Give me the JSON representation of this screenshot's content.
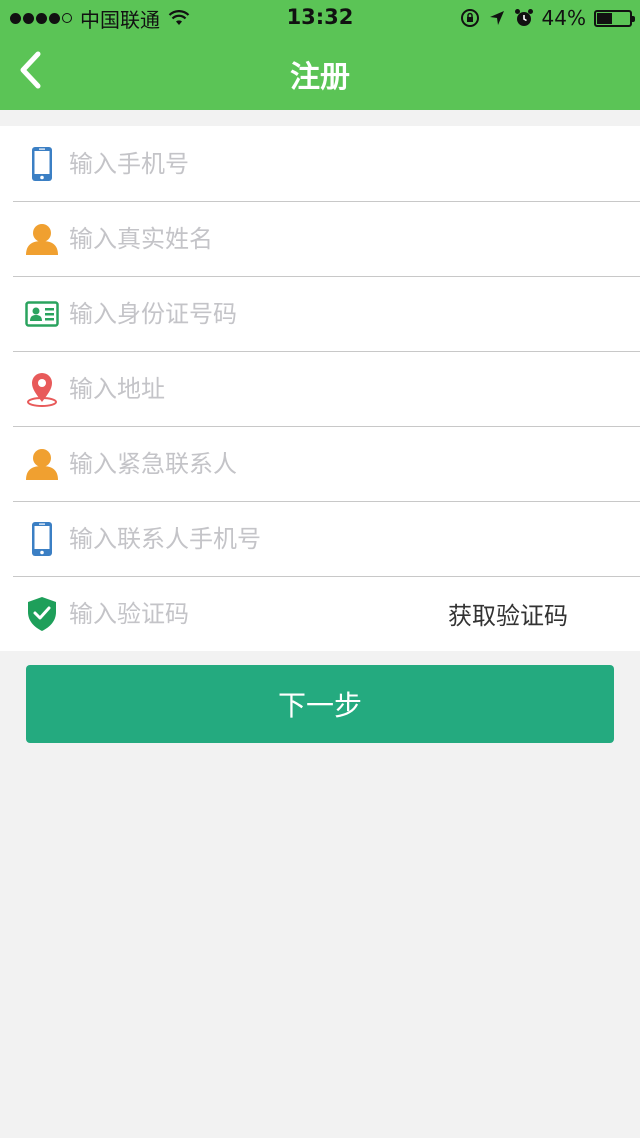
{
  "status_bar": {
    "carrier": "中国联通",
    "time": "13:32",
    "battery_text": "44%",
    "battery_level": 0.44
  },
  "nav": {
    "title": "注册",
    "back_icon": "chevron-left-icon"
  },
  "form": {
    "fields": [
      {
        "placeholder": "输入手机号",
        "icon": "phone-icon",
        "icon_color": "#3b7fc4"
      },
      {
        "placeholder": "输入真实姓名",
        "icon": "user-icon",
        "icon_color": "#f0a030"
      },
      {
        "placeholder": "输入身份证号码",
        "icon": "id-card-icon",
        "icon_color": "#2aa35e"
      },
      {
        "placeholder": "输入地址",
        "icon": "location-pin-icon",
        "icon_color": "#e85a5a"
      },
      {
        "placeholder": "输入紧急联系人",
        "icon": "user-icon",
        "icon_color": "#f0a030"
      },
      {
        "placeholder": "输入联系人手机号",
        "icon": "phone-icon",
        "icon_color": "#3b7fc4"
      },
      {
        "placeholder": "输入验证码",
        "icon": "shield-check-icon",
        "icon_color": "#1e9f5a"
      }
    ],
    "get_code_label": "获取验证码"
  },
  "next_button_label": "下一步",
  "colors": {
    "header_bg": "#5bc456",
    "button_bg": "#24aa7f",
    "page_bg": "#f2f2f2",
    "placeholder": "#c4c4c8"
  }
}
